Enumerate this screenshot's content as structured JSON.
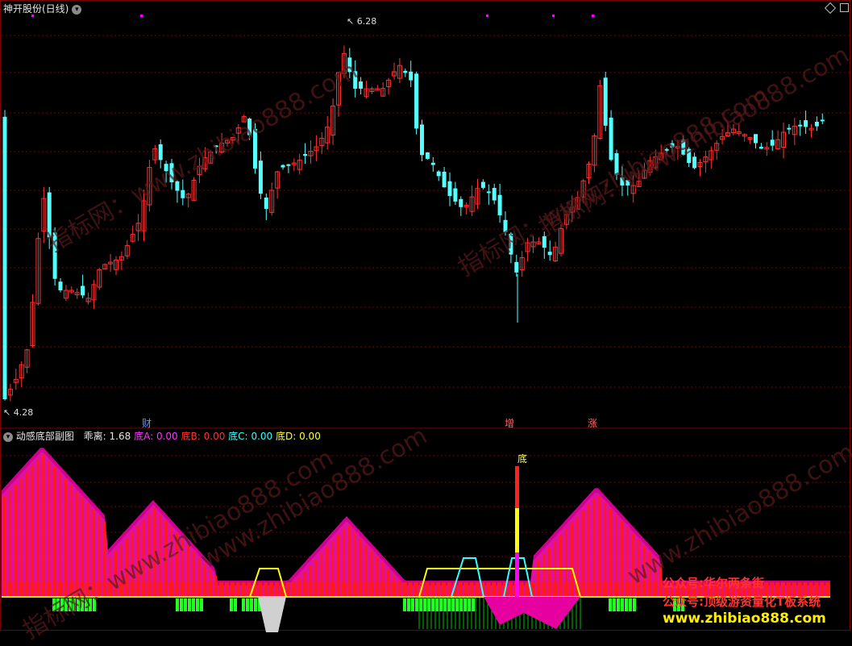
{
  "header": {
    "stock_name": "神开股份(日线)",
    "max_price_label": "6.28",
    "min_price_label": "4.28"
  },
  "event_markers": [
    {
      "label": "财",
      "color": "#5b9bff"
    },
    {
      "label": "增",
      "color": "#ff6666"
    },
    {
      "label": "涨",
      "color": "#ff6666"
    }
  ],
  "indicator": {
    "name": "动感底部副图",
    "items": [
      {
        "label": "乖离:",
        "value": "1.68",
        "color": "#e6e6e6"
      },
      {
        "label": "底A:",
        "value": "0.00",
        "color": "#ff33ff"
      },
      {
        "label": "底B:",
        "value": "0.00",
        "color": "#ff3333"
      },
      {
        "label": "底C:",
        "value": "0.00",
        "color": "#33ffff"
      },
      {
        "label": "底D:",
        "value": "0.00",
        "color": "#ffff33"
      }
    ],
    "signal_label": "底"
  },
  "watermarks": [
    "指标网：www.zhibiao888.com",
    "指标网：www.zhibiao888.com",
    "指标网：www.zhibiao888.com",
    "指标网：www.zhibiao888.com",
    "www.zhibiao888.com",
    "www.zhibiao888.com"
  ],
  "branding": {
    "line1": "公众号:华尔两条街",
    "line2": "公众号:顶级游资量化T板系统",
    "url": "www.zhibiao888.com"
  },
  "colors": {
    "up": "#ff3232",
    "down": "#54ffff",
    "frame": "#7a0000",
    "magenta": "#ff00ff",
    "green": "#00ff00",
    "yellow": "#ffff00"
  }
}
